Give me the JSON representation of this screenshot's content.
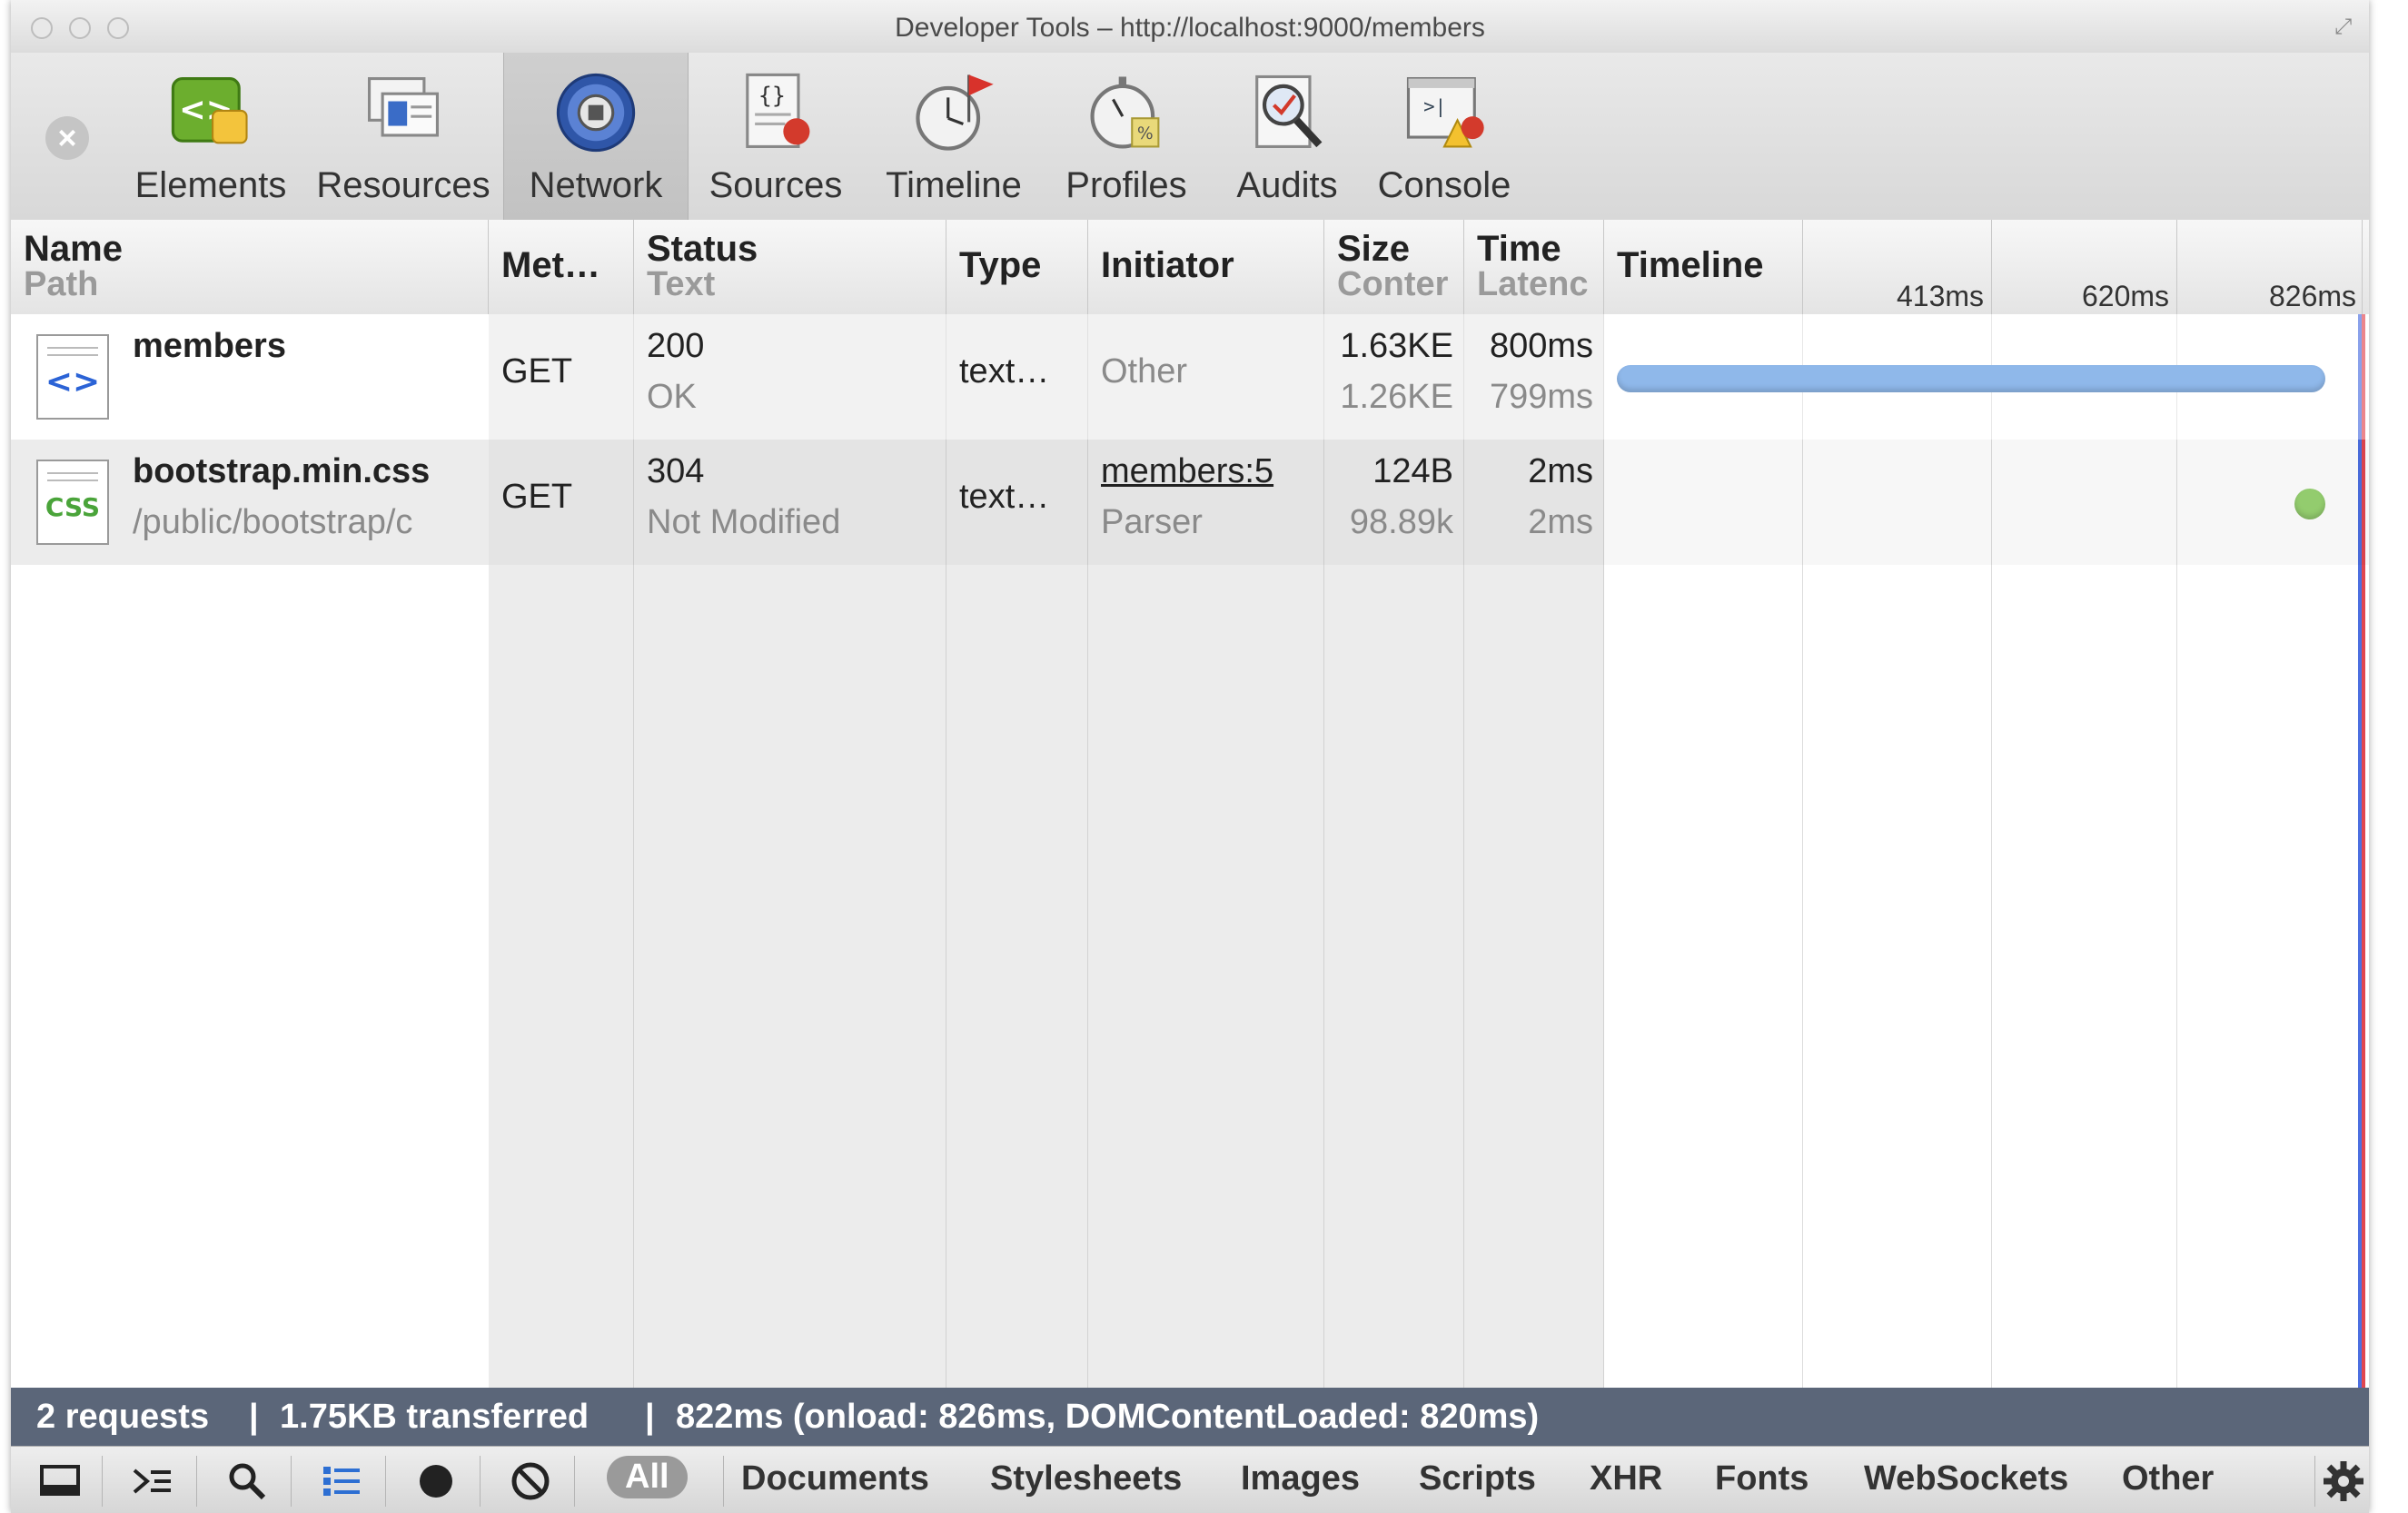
{
  "window": {
    "title": "Developer Tools – http://localhost:9000/members"
  },
  "toolbar": {
    "tabs": [
      {
        "label": "Elements",
        "icon": "elements-icon"
      },
      {
        "label": "Resources",
        "icon": "resources-icon"
      },
      {
        "label": "Network",
        "icon": "network-icon",
        "selected": true
      },
      {
        "label": "Sources",
        "icon": "sources-icon"
      },
      {
        "label": "Timeline",
        "icon": "timeline-icon"
      },
      {
        "label": "Profiles",
        "icon": "profiles-icon"
      },
      {
        "label": "Audits",
        "icon": "audits-icon"
      },
      {
        "label": "Console",
        "icon": "console-icon"
      }
    ]
  },
  "columns": {
    "name": {
      "primary": "Name",
      "secondary": "Path"
    },
    "method": "Met…",
    "status": {
      "primary": "Status",
      "secondary": "Text"
    },
    "type": "Type",
    "initiator": "Initiator",
    "size": {
      "primary": "Size",
      "secondary": "Conter"
    },
    "time": {
      "primary": "Time",
      "secondary": "Latenc"
    },
    "timeline": "Timeline",
    "ticks": [
      "413ms",
      "620ms",
      "826ms"
    ]
  },
  "requests": [
    {
      "name": "members",
      "path": "",
      "method": "GET",
      "status": "200",
      "status_text": "OK",
      "type": "text…",
      "initiator": "Other",
      "initiator_sub": "",
      "size": "1.63KE",
      "content": "1.26KE",
      "time": "800ms",
      "latency": "799ms",
      "icon": "html-file-icon",
      "bar_color": "#8fb8ea",
      "timeline_start": 0.0,
      "timeline_end": 1.0
    },
    {
      "name": "bootstrap.min.css",
      "path": "/public/bootstrap/c",
      "method": "GET",
      "status": "304",
      "status_text": "Not Modified",
      "type": "text…",
      "initiator": "members:5",
      "initiator_sub": "Parser",
      "size": "124B",
      "content": "98.89k",
      "time": "2ms",
      "latency": "2ms",
      "icon": "css-file-icon",
      "bar_color": "#93cc6e",
      "timeline_start": 0.99,
      "timeline_end": 1.0
    }
  ],
  "status": {
    "requests": "2 requests",
    "transferred": "1.75KB transferred",
    "timing": "822ms (onload: 826ms, DOMContentLoaded: 820ms)",
    "separator": "|"
  },
  "filters": [
    "All",
    "Documents",
    "Stylesheets",
    "Images",
    "Scripts",
    "XHR",
    "Fonts",
    "WebSockets",
    "Other"
  ],
  "bottom_icons": [
    "dock-icon",
    "console-drawer-icon",
    "search-icon",
    "large-rows-icon",
    "record-icon",
    "clear-icon",
    "settings-icon"
  ],
  "colors": {
    "statusbar": "#5b6679",
    "onload_line": "#e0464f",
    "domcontent_line": "#4c6fe0"
  }
}
